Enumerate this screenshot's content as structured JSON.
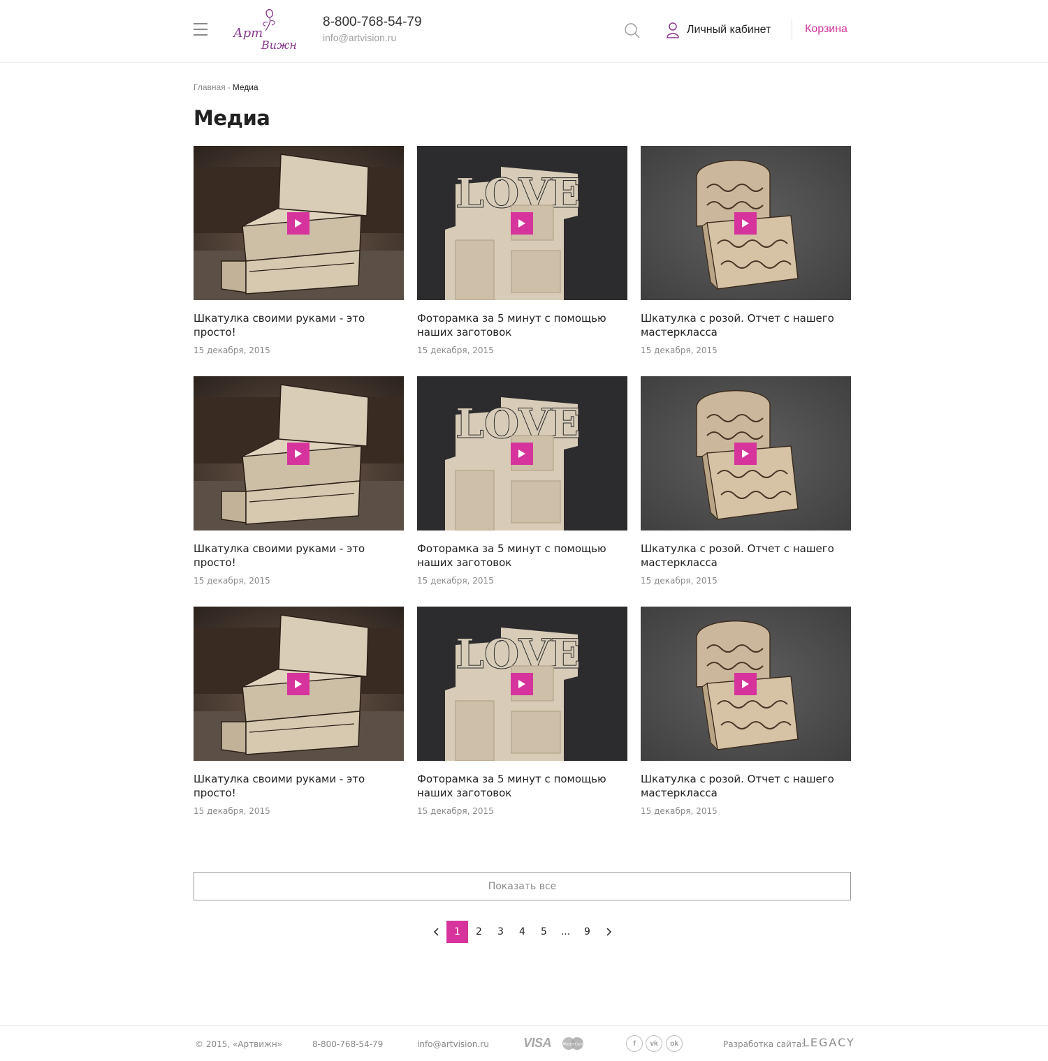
{
  "header": {
    "logo_text": "Арт Вижн",
    "phone": "8-800-768-54-79",
    "email": "info@artvision.ru",
    "account_label": "Личный кабинет",
    "cart_label": "Корзина",
    "icons": [
      "menu-icon",
      "search-icon",
      "user-icon"
    ]
  },
  "breadcrumb": {
    "home": "Главная",
    "separator": "-",
    "current": "Медиа"
  },
  "page_title": "Медиа",
  "items": [
    {
      "title": "Шкатулка своими руками - это просто!",
      "date": "15 декабря, 2015",
      "image": "wooden-box-drawers"
    },
    {
      "title": "Фоторамка за 5 минут с помощью наших заготовок",
      "date": "15 декабря, 2015",
      "image": "love-photo-frame"
    },
    {
      "title": "Шкатулка с розой. Отчет с нашего мастеркласса",
      "date": "15 декабря, 2015",
      "image": "carved-chest"
    },
    {
      "title": "Шкатулка своими руками - это просто!",
      "date": "15 декабря, 2015",
      "image": "wooden-box-drawers"
    },
    {
      "title": "Фоторамка за 5 минут с помощью наших заготовок",
      "date": "15 декабря, 2015",
      "image": "love-photo-frame"
    },
    {
      "title": "Шкатулка с розой. Отчет с нашего мастеркласса",
      "date": "15 декабря, 2015",
      "image": "carved-chest"
    },
    {
      "title": "Шкатулка своими руками - это просто!",
      "date": "15 декабря, 2015",
      "image": "wooden-box-drawers"
    },
    {
      "title": "Фоторамка за 5 минут с помощью наших заготовок",
      "date": "15 декабря, 2015",
      "image": "love-photo-frame"
    },
    {
      "title": "Шкатулка с розой. Отчет с нашего мастеркласса",
      "date": "15 декабря, 2015",
      "image": "carved-chest"
    }
  ],
  "show_all_label": "Показать все",
  "pagination": {
    "prev_icon": "chevron-left-icon",
    "next_icon": "chevron-right-icon",
    "pages": [
      "1",
      "2",
      "3",
      "4",
      "5",
      "...",
      "9"
    ],
    "current": "1"
  },
  "footer": {
    "copyright": "© 2015, «Артвижн»",
    "phone": "8-800-768-54-79",
    "email": "info@artvision.ru",
    "payment_visa": "VISA",
    "payment_mastercard": "MasterCard",
    "social": [
      "f",
      "vk",
      "ok"
    ],
    "dev_label": "Разработка сайта:",
    "dev_name": "LEGACY"
  },
  "colors": {
    "accent": "#d6349c",
    "text": "#222222",
    "muted": "#8a8a8a",
    "logo": "#8a3a8e"
  }
}
